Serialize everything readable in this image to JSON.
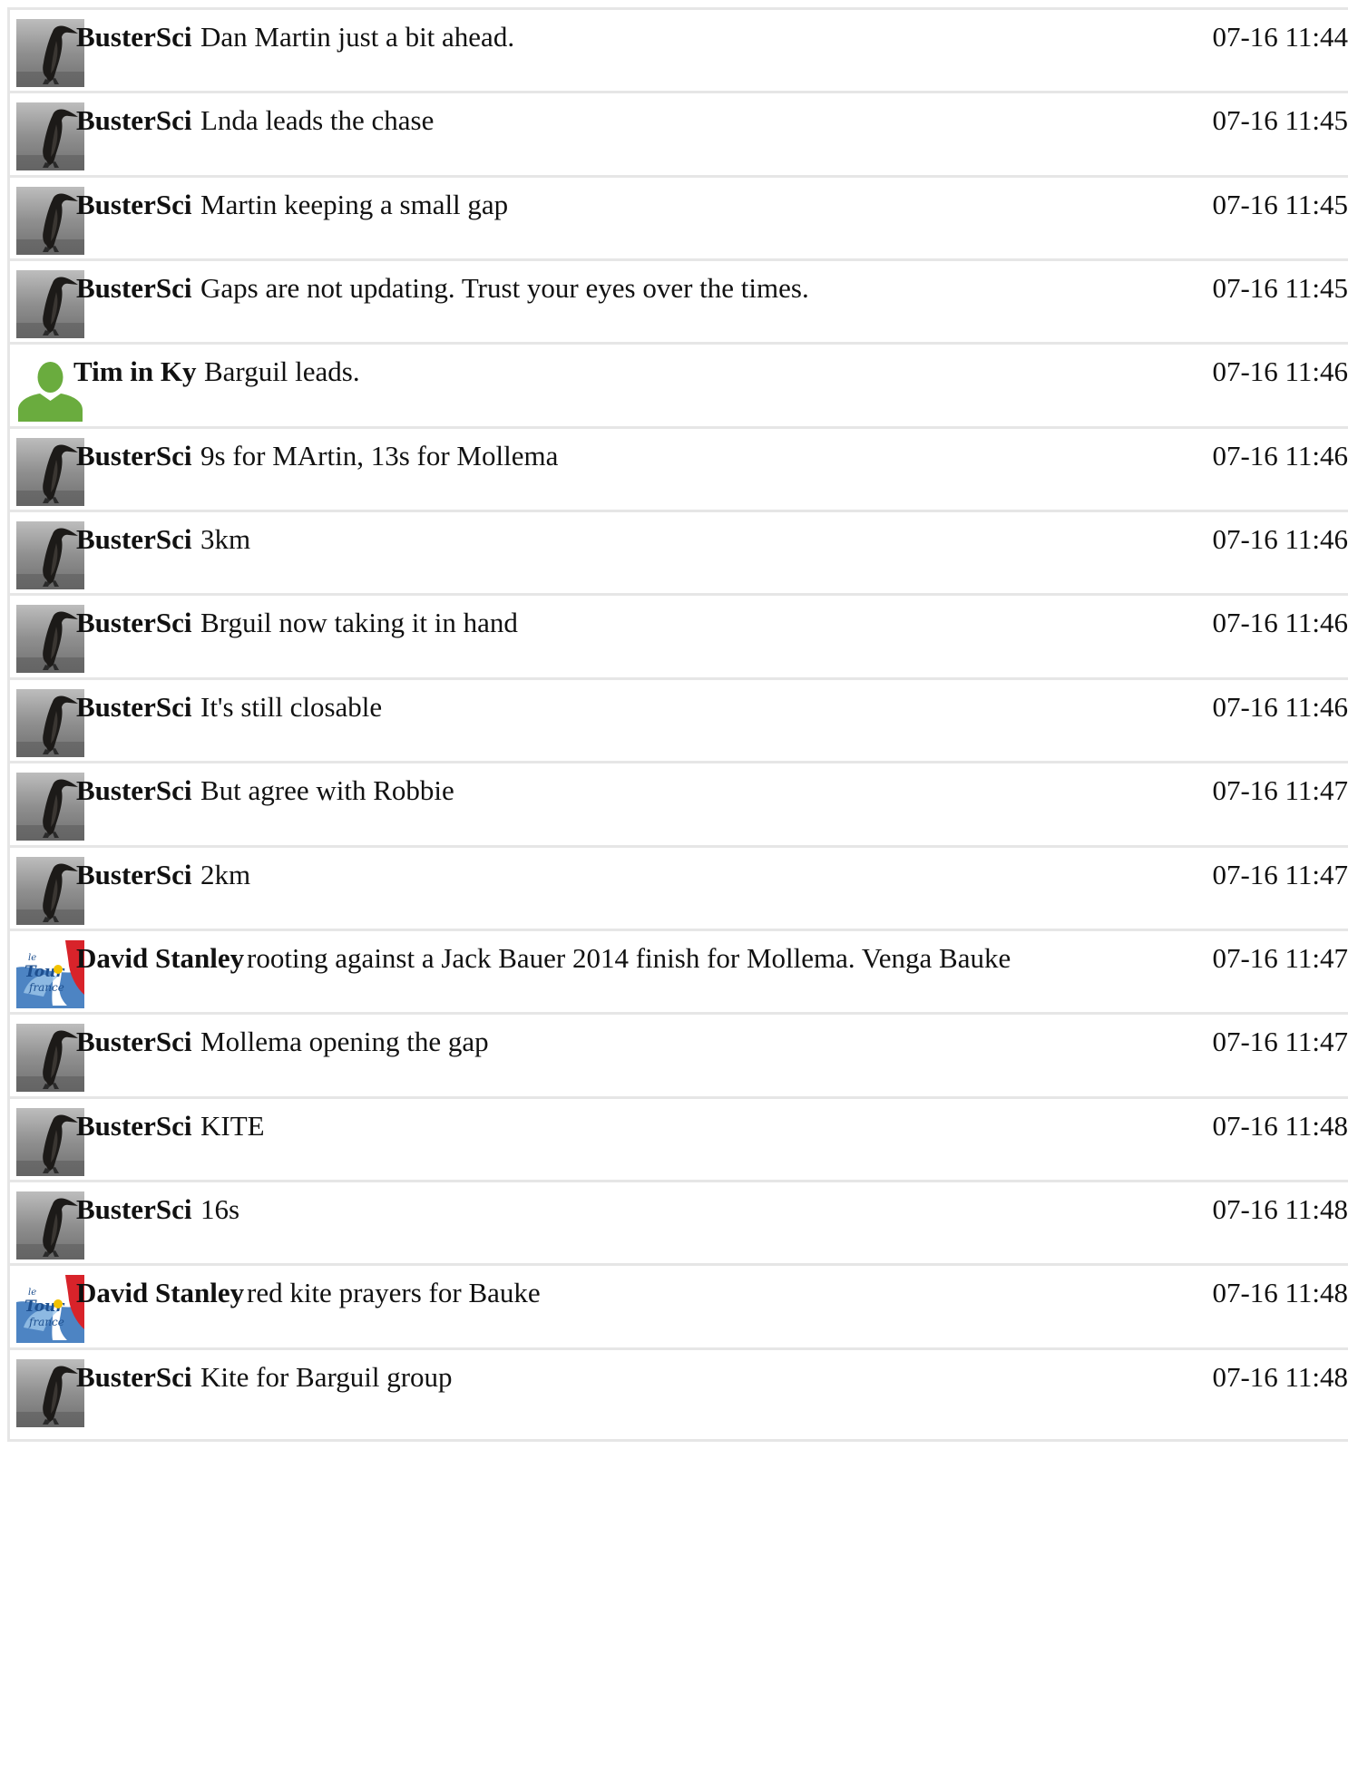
{
  "messages": [
    {
      "user": "BusterSci",
      "avatar": "penguin",
      "text": "Dan Martin just a bit ahead.",
      "time": "07-16 11:44"
    },
    {
      "user": "BusterSci",
      "avatar": "penguin",
      "text": "Lnda leads the chase",
      "time": "07-16 11:45"
    },
    {
      "user": "BusterSci",
      "avatar": "penguin",
      "text": "Martin keeping a small gap",
      "time": "07-16 11:45"
    },
    {
      "user": "BusterSci",
      "avatar": "penguin",
      "text": "Gaps are not updating. Trust your eyes over the times.",
      "time": "07-16 11:45"
    },
    {
      "user": "Tim in Ky",
      "avatar": "default-user",
      "text": "Barguil leads.",
      "time": "07-16 11:46"
    },
    {
      "user": "BusterSci",
      "avatar": "penguin",
      "text": "9s for MArtin, 13s for Mollema",
      "time": "07-16 11:46"
    },
    {
      "user": "BusterSci",
      "avatar": "penguin",
      "text": "3km",
      "time": "07-16 11:46"
    },
    {
      "user": "BusterSci",
      "avatar": "penguin",
      "text": "Brguil now taking it in hand",
      "time": "07-16 11:46"
    },
    {
      "user": "BusterSci",
      "avatar": "penguin",
      "text": "It's still closable",
      "time": "07-16 11:46"
    },
    {
      "user": "BusterSci",
      "avatar": "penguin",
      "text": "But agree with Robbie",
      "time": "07-16 11:47"
    },
    {
      "user": "BusterSci",
      "avatar": "penguin",
      "text": "2km",
      "time": "07-16 11:47"
    },
    {
      "user": "David Stanley",
      "avatar": "tour-de-france-logo",
      "text": "rooting against a Jack Bauer 2014 finish for Mollema. Venga Bauke",
      "time": "07-16 11:47"
    },
    {
      "user": "BusterSci",
      "avatar": "penguin",
      "text": "Mollema opening the gap",
      "time": "07-16 11:47"
    },
    {
      "user": "BusterSci",
      "avatar": "penguin",
      "text": "KITE",
      "time": "07-16 11:48"
    },
    {
      "user": "BusterSci",
      "avatar": "penguin",
      "text": "16s",
      "time": "07-16 11:48"
    },
    {
      "user": "David Stanley",
      "avatar": "tour-de-france-logo",
      "text": "red kite prayers for Bauke",
      "time": "07-16 11:48"
    },
    {
      "user": "BusterSci",
      "avatar": "penguin",
      "text": "Kite for Barguil group",
      "time": "07-16 11:48"
    }
  ],
  "avatar_logo_text": "le Tour de France",
  "colors": {
    "border": "#e6e6e6",
    "default_avatar": "#6aac3e",
    "penguin_bg": "#9a9a9a"
  }
}
